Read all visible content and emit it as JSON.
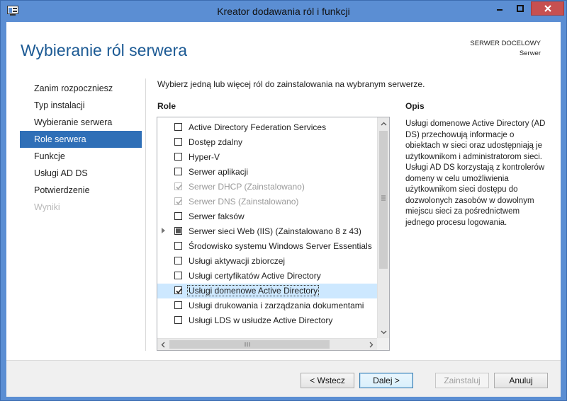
{
  "window": {
    "title": "Kreator dodawania ról i funkcji"
  },
  "header": {
    "title": "Wybieranie ról serwera",
    "dest_label": "SERWER DOCELOWY",
    "dest_value": "Serwer"
  },
  "nav": [
    {
      "label": "Zanim rozpoczniesz",
      "state": "normal"
    },
    {
      "label": "Typ instalacji",
      "state": "normal"
    },
    {
      "label": "Wybieranie serwera",
      "state": "normal"
    },
    {
      "label": "Role serwera",
      "state": "active"
    },
    {
      "label": "Funkcje",
      "state": "normal"
    },
    {
      "label": "Usługi AD DS",
      "state": "normal"
    },
    {
      "label": "Potwierdzenie",
      "state": "normal"
    },
    {
      "label": "Wyniki",
      "state": "disabled"
    }
  ],
  "content": {
    "instruction": "Wybierz jedną lub więcej ról do zainstalowania na wybranym serwerze.",
    "roles_label": "Role",
    "description_label": "Opis",
    "description": "Usługi domenowe Active Directory (AD DS) przechowują informacje o obiektach w sieci oraz udostępniają je użytkownikom i administratorom sieci. Usługi AD DS korzystają z kontrolerów domeny w celu umożliwienia użytkownikom sieci dostępu do dozwolonych zasobów w dowolnym miejscu sieci za pośrednictwem jednego procesu logowania."
  },
  "roles": [
    {
      "label": "Active Directory Federation Services",
      "state": "unchecked"
    },
    {
      "label": "Dostęp zdalny",
      "state": "unchecked"
    },
    {
      "label": "Hyper-V",
      "state": "unchecked"
    },
    {
      "label": "Serwer aplikacji",
      "state": "unchecked"
    },
    {
      "label": "Serwer DHCP (Zainstalowano)",
      "state": "checked-disabled"
    },
    {
      "label": "Serwer DNS (Zainstalowano)",
      "state": "checked-disabled"
    },
    {
      "label": "Serwer faksów",
      "state": "unchecked"
    },
    {
      "label": "Serwer sieci Web (IIS) (Zainstalowano 8 z 43)",
      "state": "partial",
      "expandable": true
    },
    {
      "label": "Środowisko systemu Windows Server Essentials",
      "state": "unchecked"
    },
    {
      "label": "Usługi aktywacji zbiorczej",
      "state": "unchecked"
    },
    {
      "label": "Usługi certyfikatów Active Directory",
      "state": "unchecked"
    },
    {
      "label": "Usługi domenowe Active Directory",
      "state": "checked",
      "selected": true
    },
    {
      "label": "Usługi drukowania i zarządzania dokumentami",
      "state": "unchecked"
    },
    {
      "label": "Usługi LDS w usłudze Active Directory",
      "state": "unchecked"
    }
  ],
  "buttons": {
    "back": "< Wstecz",
    "next": "Dalej >",
    "install": "Zainstaluj",
    "cancel": "Anuluj"
  },
  "colors": {
    "accent": "#2f6fb7",
    "title_blue": "#1c5a94",
    "frame": "#5b8ed3"
  }
}
